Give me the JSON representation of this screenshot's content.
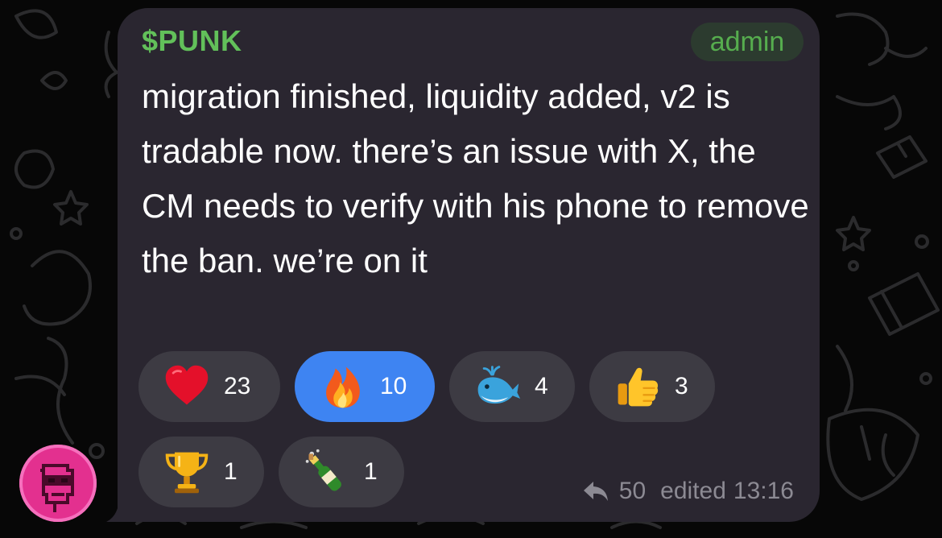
{
  "message": {
    "sender": "$PUNK",
    "role_badge": "admin",
    "text": "migration finished, liquidity added, v2 is tradable now. there’s an issue with X, the CM needs to verify with his phone to remove the ban. we’re on it",
    "replies": "50",
    "edited_label": "edited",
    "time": "13:16"
  },
  "reactions": [
    {
      "emoji": "heart",
      "count": "23",
      "selected": false
    },
    {
      "emoji": "fire",
      "count": "10",
      "selected": true
    },
    {
      "emoji": "whale",
      "count": "4",
      "selected": false
    },
    {
      "emoji": "thumbs-up",
      "count": "3",
      "selected": false
    },
    {
      "emoji": "trophy",
      "count": "1",
      "selected": false
    },
    {
      "emoji": "champagne",
      "count": "1",
      "selected": false
    }
  ],
  "colors": {
    "sender": "#62c05a",
    "bubble": "#2a2630",
    "reaction": "#3d3b43",
    "reaction_selected": "#3e84f2",
    "meta": "#8c8a93"
  }
}
